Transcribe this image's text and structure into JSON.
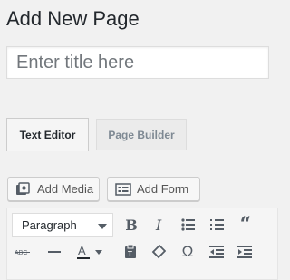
{
  "header": {
    "title": "Add New Page"
  },
  "title_field": {
    "placeholder": "Enter title here",
    "value": ""
  },
  "tabs": [
    {
      "label": "Text Editor",
      "active": true
    },
    {
      "label": "Page Builder",
      "active": false
    }
  ],
  "media_buttons": [
    {
      "label": "Add Media",
      "icon": "add-media-icon"
    },
    {
      "label": "Add Form",
      "icon": "form-icon"
    }
  ],
  "toolbar": {
    "format_value": "Paragraph",
    "row1_icons": [
      "bold-icon",
      "italic-icon",
      "bulleted-list-icon",
      "numbered-list-icon",
      "blockquote-icon"
    ],
    "row2_icons": [
      "strikethrough-icon",
      "horizontal-line-icon",
      "text-color-icon",
      "paste-as-text-icon",
      "clear-formatting-icon",
      "special-character-icon",
      "outdent-icon",
      "indent-icon"
    ]
  },
  "colors": {
    "background": "#f1f1f1",
    "text": "#23282d",
    "placeholder": "#72777c",
    "icon": "#555d66"
  }
}
